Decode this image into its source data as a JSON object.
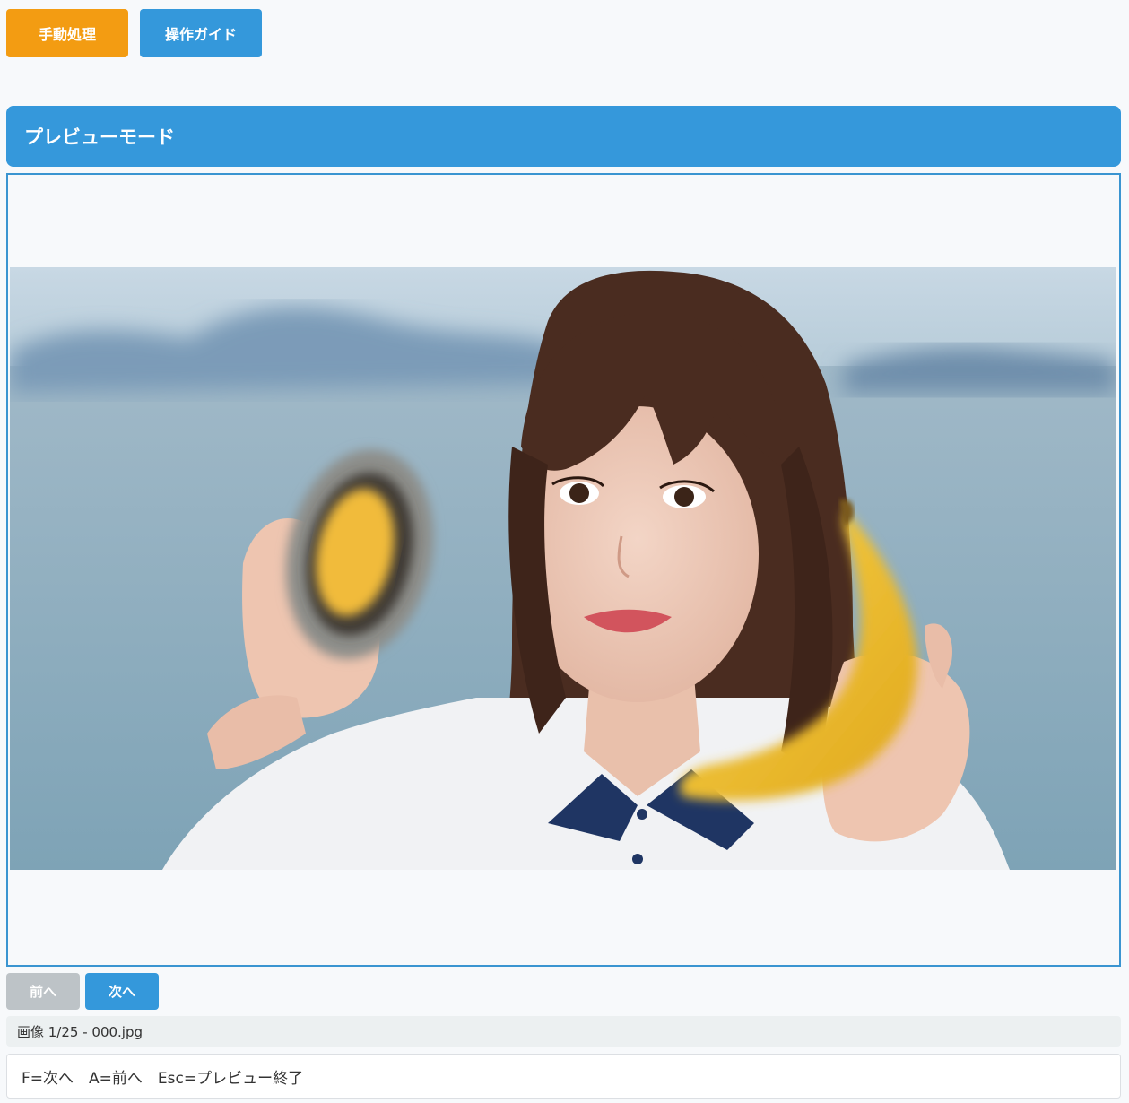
{
  "toolbar": {
    "manual_label": "手動処理",
    "guide_label": "操作ガイド"
  },
  "header": {
    "title": "プレビューモード"
  },
  "preview": {
    "image_description": "photo-portrait"
  },
  "navigation": {
    "prev_label": "前へ",
    "next_label": "次へ"
  },
  "status": {
    "text": "画像 1/25 - 000.jpg"
  },
  "shortcuts": {
    "text": "F=次へ　A=前へ　Esc=プレビュー終了"
  },
  "colors": {
    "manual_button": "#f39c12",
    "primary": "#3498db",
    "disabled_button": "#bdc3c7",
    "status_background": "#ecf0f1"
  }
}
